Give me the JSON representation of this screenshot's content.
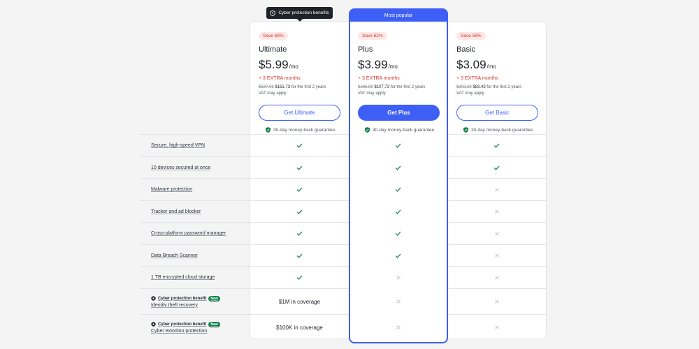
{
  "tooltip": {
    "label": "Cyber protection benefits"
  },
  "plans": [
    {
      "badge": "Save 69%",
      "name": "Ultimate",
      "price": "$5.99",
      "per": "/mo",
      "extra": "+ 3 EXTRA months",
      "original": "$537.03",
      "discounted": "$161.73",
      "terms": "for the first 2 years",
      "vat": "VAT may apply",
      "cta": "Get Ultimate",
      "guarantee": "30-day money-back guarantee"
    },
    {
      "header": "Most popular",
      "badge": "Save 62%",
      "name": "Plus",
      "price": "$3.99",
      "per": "/mo",
      "extra": "+ 3 EXTRA months",
      "original": "$285.93",
      "discounted": "$107.73",
      "terms": "for the first 2 years",
      "vat": "VAT may apply",
      "cta": "Get Plus",
      "guarantee": "30-day money-back guarantee"
    },
    {
      "badge": "Save 58%",
      "name": "Basic",
      "price": "$3.09",
      "per": "/mo",
      "extra": "+ 3 EXTRA months",
      "original": "$202.23",
      "discounted": "$83.43",
      "terms": "for the first 2 years",
      "vat": "VAT may apply",
      "cta": "Get Basic",
      "guarantee": "30-day money-back guarantee"
    }
  ],
  "features": [
    {
      "label": "Secure, high-speed VPN",
      "values": [
        "check",
        "check",
        "check"
      ]
    },
    {
      "label": "10 devices secured at once",
      "values": [
        "check",
        "check",
        "check"
      ]
    },
    {
      "label": "Malware protection",
      "values": [
        "check",
        "check",
        "cross"
      ]
    },
    {
      "label": "Tracker and ad blocker",
      "values": [
        "check",
        "check",
        "cross"
      ]
    },
    {
      "label": "Cross-platform password manager",
      "values": [
        "check",
        "check",
        "cross"
      ]
    },
    {
      "label": "Data Breach Scanner",
      "values": [
        "check",
        "check",
        "cross"
      ]
    },
    {
      "label": "1 TB encrypted cloud storage",
      "values": [
        "check",
        "cross",
        "cross"
      ]
    }
  ],
  "benefits": [
    {
      "tag": "Cyber protection benefit",
      "badge": "New",
      "label": "Identity theft recovery",
      "coverage": "$1M in coverage"
    },
    {
      "tag": "Cyber protection benefit",
      "badge": "New",
      "label": "Cyber extortion protection",
      "coverage": "$100K in coverage"
    }
  ],
  "colors": {
    "accent": "#3e5ff5",
    "check": "#16824e",
    "cross": "#c4c7cc",
    "save": "#d6342c"
  }
}
